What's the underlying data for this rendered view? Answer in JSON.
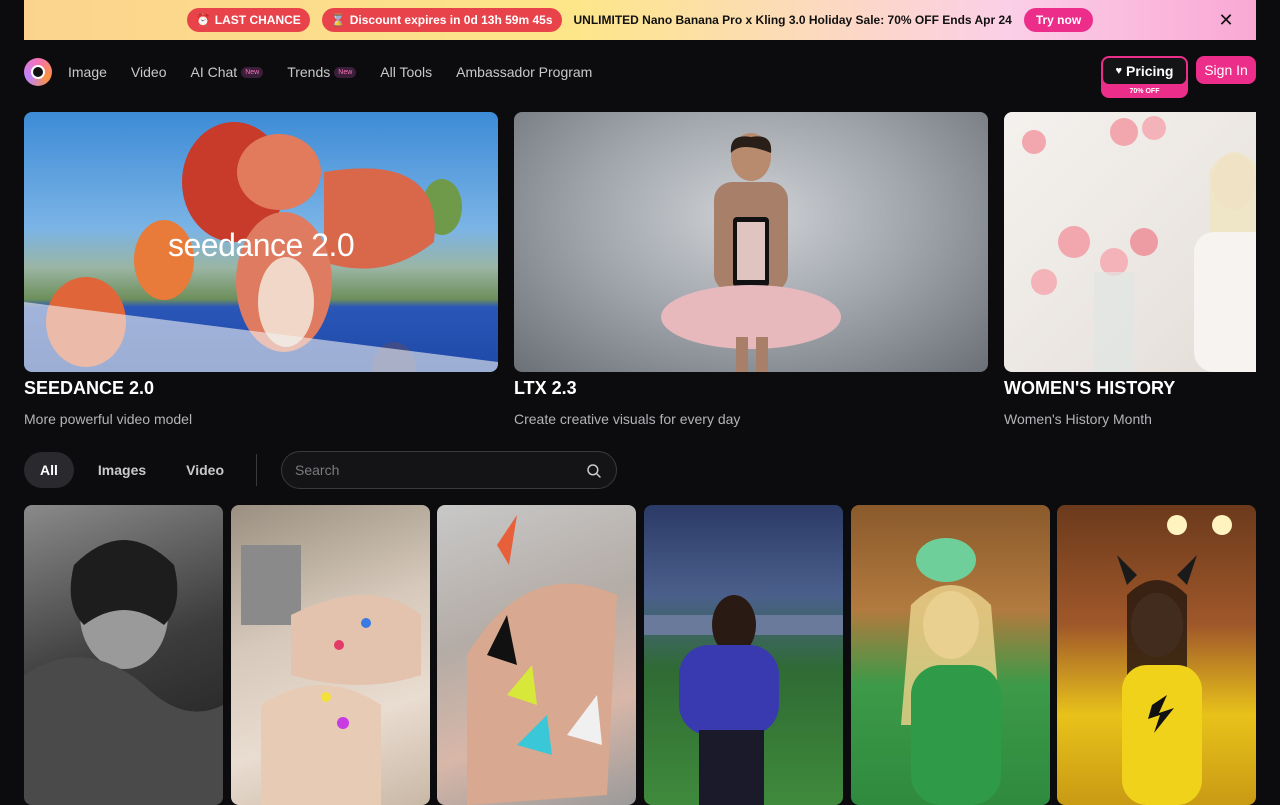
{
  "banner": {
    "last_chance": "LAST CHANCE",
    "discount": "Discount expires in 0d 13h 59m 45s",
    "sale_text": "UNLIMITED Nano Banana Pro x Kling 3.0 Holiday Sale: 70% OFF Ends Apr 24",
    "try_now": "Try now"
  },
  "nav": {
    "items": [
      {
        "label": "Image"
      },
      {
        "label": "Video"
      },
      {
        "label": "AI Chat",
        "badge": "New"
      },
      {
        "label": "Trends",
        "badge": "New"
      },
      {
        "label": "All Tools"
      },
      {
        "label": "Ambassador Program"
      }
    ],
    "pricing_label": "Pricing",
    "pricing_offer": "70% OFF",
    "sign_in": "Sign In"
  },
  "featured": [
    {
      "title": "SEEDANCE 2.0",
      "subtitle": "More powerful video model",
      "overlay": "seedance 2.0"
    },
    {
      "title": "LTX 2.3",
      "subtitle": "Create creative visuals for every day"
    },
    {
      "title": "WOMEN'S HISTORY",
      "subtitle": "Women's History Month"
    }
  ],
  "filters": {
    "tabs": [
      "All",
      "Images",
      "Video"
    ],
    "active": "All",
    "search_placeholder": "Search"
  },
  "colors": {
    "accent": "#ec2d8a",
    "background": "#0c0c0e"
  }
}
